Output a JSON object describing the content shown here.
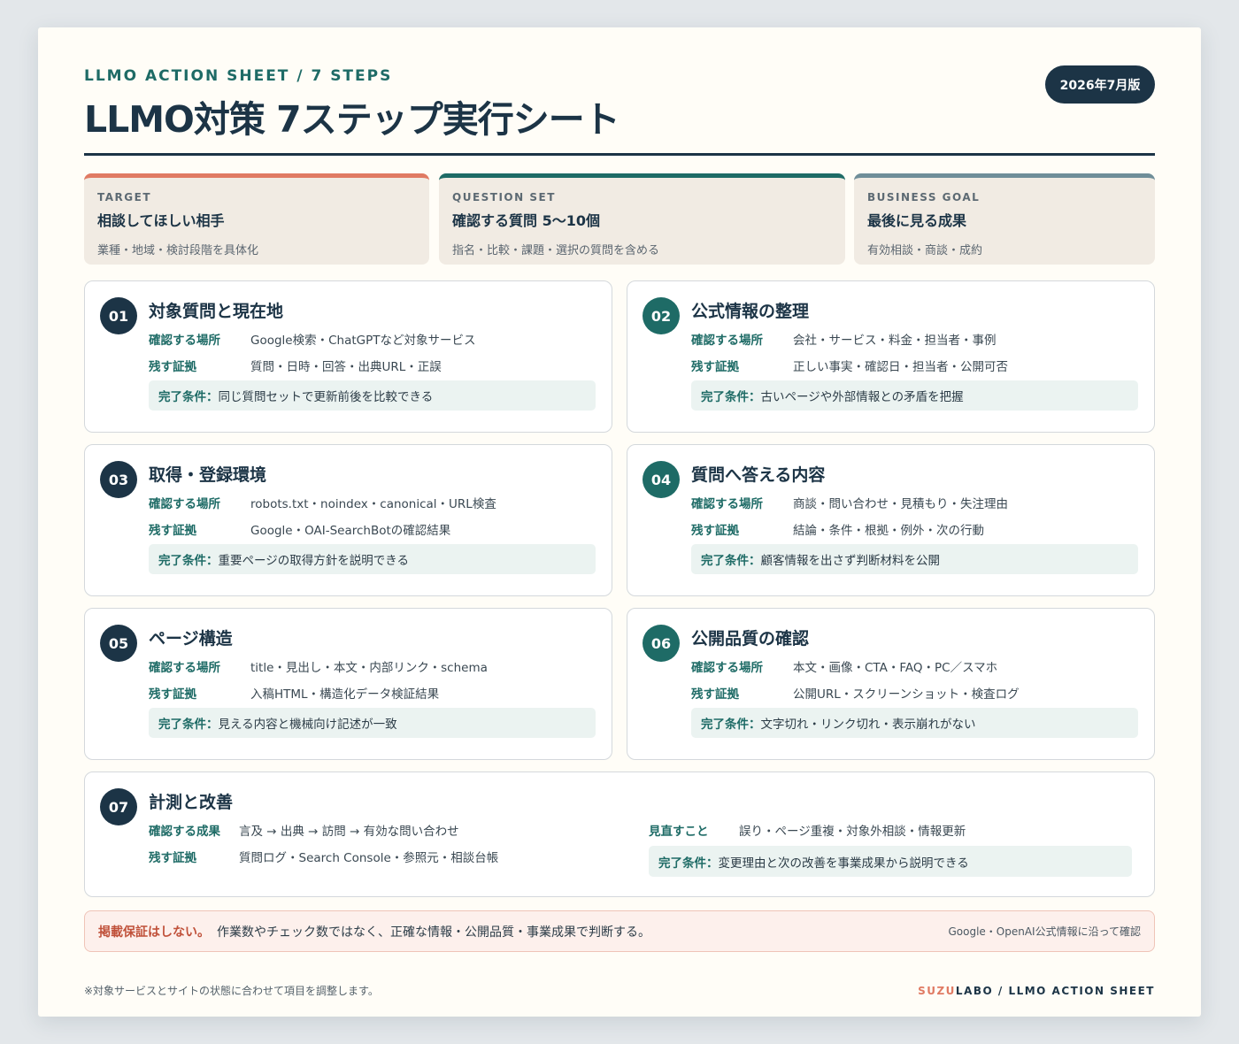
{
  "header": {
    "kicker": "LLMO ACTION SHEET / 7 STEPS",
    "title": "LLMO対策 7ステップ実行シート",
    "edition": "2026年7月版"
  },
  "top_cards": [
    {
      "label": "TARGET",
      "heading": "相談してほしい相手",
      "sub": "業種・地域・検討段階を具体化",
      "accent": "#e07a63"
    },
    {
      "label": "QUESTION SET",
      "heading": "確認する質問 5〜10個",
      "sub": "指名・比較・課題・選択の質問を含める",
      "accent": "#1e6b66"
    },
    {
      "label": "BUSINESS GOAL",
      "heading": "最後に見る成果",
      "sub": "有効相談・商談・成約",
      "accent": "#6f8e99"
    }
  ],
  "steps": [
    {
      "num": "01",
      "title": "対象質問と現在地",
      "k1": "確認する場所",
      "v1": "Google検索・ChatGPTなど対象サービス",
      "k2": "残す証拠",
      "v2": "質問・日時・回答・出典URL・正誤",
      "done_label": "完了条件：",
      "done": "同じ質問セットで更新前後を比較できる"
    },
    {
      "num": "02",
      "title": "公式情報の整理",
      "k1": "確認する場所",
      "v1": "会社・サービス・料金・担当者・事例",
      "k2": "残す証拠",
      "v2": "正しい事実・確認日・担当者・公開可否",
      "done_label": "完了条件：",
      "done": "古いページや外部情報との矛盾を把握"
    },
    {
      "num": "03",
      "title": "取得・登録環境",
      "k1": "確認する場所",
      "v1": "robots.txt・noindex・canonical・URL検査",
      "k2": "残す証拠",
      "v2": "Google・OAI-SearchBotの確認結果",
      "done_label": "完了条件：",
      "done": "重要ページの取得方針を説明できる"
    },
    {
      "num": "04",
      "title": "質問へ答える内容",
      "k1": "確認する場所",
      "v1": "商談・問い合わせ・見積もり・失注理由",
      "k2": "残す証拠",
      "v2": "結論・条件・根拠・例外・次の行動",
      "done_label": "完了条件：",
      "done": "顧客情報を出さず判断材料を公開"
    },
    {
      "num": "05",
      "title": "ページ構造",
      "k1": "確認する場所",
      "v1": "title・見出し・本文・内部リンク・schema",
      "k2": "残す証拠",
      "v2": "入稿HTML・構造化データ検証結果",
      "done_label": "完了条件：",
      "done": "見える内容と機械向け記述が一致"
    },
    {
      "num": "06",
      "title": "公開品質の確認",
      "k1": "確認する場所",
      "v1": "本文・画像・CTA・FAQ・PC／スマホ",
      "k2": "残す証拠",
      "v2": "公開URL・スクリーンショット・検査ログ",
      "done_label": "完了条件：",
      "done": "文字切れ・リンク切れ・表示崩れがない"
    }
  ],
  "step7": {
    "num": "07",
    "title": "計測と改善",
    "k1": "確認する成果",
    "v1": "言及 → 出典 → 訪問 → 有効な問い合わせ",
    "k2": "残す証拠",
    "v2": "質問ログ・Search Console・参照元・相談台帳",
    "k3": "見直すこと",
    "v3": "誤り・ページ重複・対象外相談・情報更新",
    "done_label": "完了条件：",
    "done": "変更理由と次の改善を事業成果から説明できる"
  },
  "notice": {
    "warn": "掲載保証はしない。",
    "message": "作業数やチェック数ではなく、正確な情報・公開品質・事業成果で判断する。",
    "source": "Google・OpenAI公式情報に沿って確認"
  },
  "footer": {
    "note": "※対象サービスとサイトの状態に合わせて項目を調整します。",
    "brand_accent": "SUZU",
    "brand_rest": "LABO / LLMO ACTION SHEET"
  }
}
